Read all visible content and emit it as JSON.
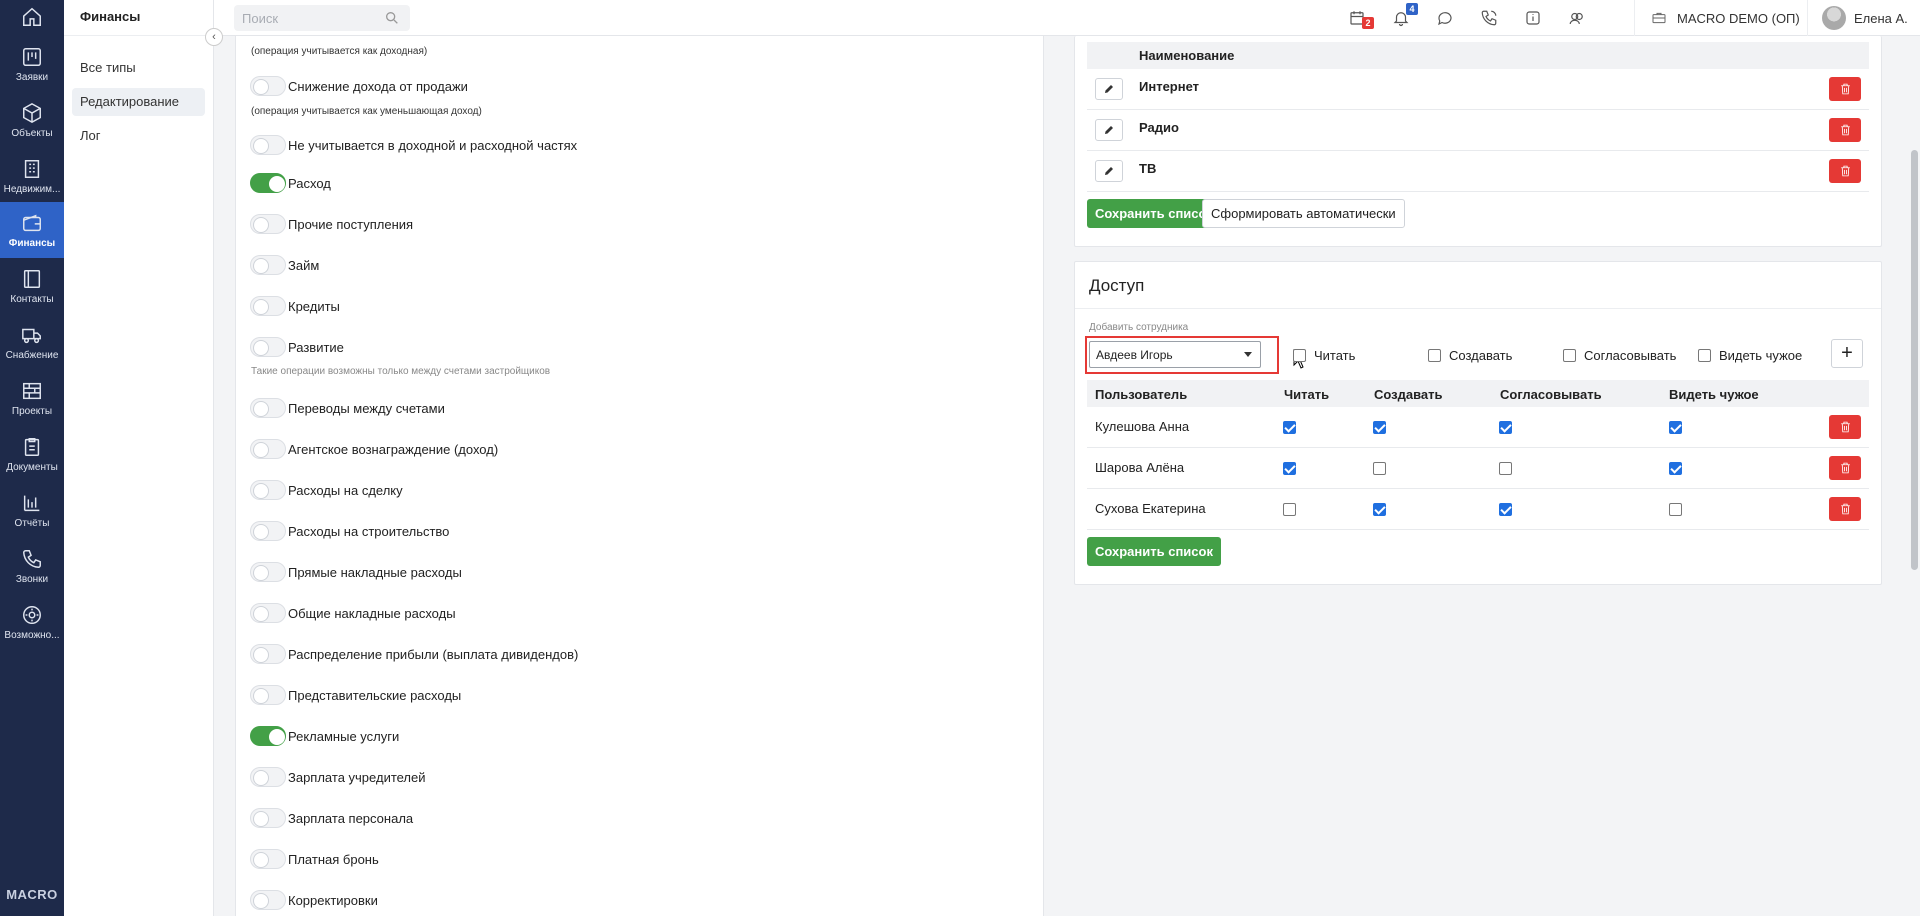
{
  "nav": {
    "items": [
      {
        "label": "",
        "icon": "home-icon"
      },
      {
        "label": "Заявки",
        "icon": "requests-icon"
      },
      {
        "label": "Объекты",
        "icon": "cube-icon"
      },
      {
        "label": "Недвижим...",
        "icon": "building-icon"
      },
      {
        "label": "Финансы",
        "icon": "wallet-icon"
      },
      {
        "label": "Контакты",
        "icon": "contacts-icon"
      },
      {
        "label": "Снабжение",
        "icon": "truck-icon"
      },
      {
        "label": "Проекты",
        "icon": "bricks-icon"
      },
      {
        "label": "Документы",
        "icon": "clipboard-icon"
      },
      {
        "label": "Отчёты",
        "icon": "report-icon"
      },
      {
        "label": "Звонки",
        "icon": "phone-icon"
      },
      {
        "label": "Возможно...",
        "icon": "gear-icon"
      }
    ],
    "brand": "MACRO"
  },
  "subnav": {
    "title": "Финансы",
    "items": [
      "Все типы",
      "Редактирование",
      "Лог"
    ]
  },
  "topbar": {
    "search_placeholder": "Поиск",
    "calendar_badge": "2",
    "bell_badge": "4",
    "company": "MACRO DEMO (ОП)",
    "user": "Елена А."
  },
  "toggles": {
    "top_hint": "(операция учитывается как доходная)",
    "items": [
      {
        "label": "Снижение дохода от продажи",
        "on": false,
        "hint": "(операция учитывается как уменьшающая доход)"
      },
      {
        "label": "Не учитывается в доходной и расходной частях",
        "on": false
      },
      {
        "label": "Расход",
        "on": true
      },
      {
        "label": "Прочие поступления",
        "on": false
      },
      {
        "label": "Займ",
        "on": false
      },
      {
        "label": "Кредиты",
        "on": false
      },
      {
        "label": "Развитие",
        "on": false,
        "hint": "Такие операции возможны только между счетами застройщиков"
      },
      {
        "label": "Переводы между счетами",
        "on": false
      },
      {
        "label": "Агентское вознаграждение (доход)",
        "on": false
      },
      {
        "label": "Расходы на сделку",
        "on": false
      },
      {
        "label": "Расходы на строительство",
        "on": false
      },
      {
        "label": "Прямые накладные расходы",
        "on": false
      },
      {
        "label": "Общие накладные расходы",
        "on": false
      },
      {
        "label": "Распределение прибыли (выплата дивидендов)",
        "on": false
      },
      {
        "label": "Представительские расходы",
        "on": false
      },
      {
        "label": "Рекламные услуги",
        "on": true
      },
      {
        "label": "Зарплата учредителей",
        "on": false
      },
      {
        "label": "Зарплата персонала",
        "on": false
      },
      {
        "label": "Платная бронь",
        "on": false
      },
      {
        "label": "Корректировки",
        "on": false
      }
    ]
  },
  "names_card": {
    "column": "Наименование",
    "rows": [
      "Интернет",
      "Радио",
      "ТВ"
    ],
    "save_label": "Сохранить список",
    "auto_label": "Сформировать автоматически"
  },
  "access_card": {
    "title": "Доступ",
    "add_label": "Добавить сотрудника",
    "selected_employee": "Авдеев Игорь",
    "perm_labels": [
      "Читать",
      "Создавать",
      "Согласовывать",
      "Видеть чужое"
    ],
    "columns": [
      "Пользователь",
      "Читать",
      "Создавать",
      "Согласовывать",
      "Видеть чужое"
    ],
    "rows": [
      {
        "user": "Кулешова Анна",
        "perms": [
          true,
          true,
          true,
          true
        ]
      },
      {
        "user": "Шарова Алёна",
        "perms": [
          true,
          false,
          false,
          true
        ]
      },
      {
        "user": "Сухова Екатерина",
        "perms": [
          false,
          true,
          true,
          false
        ]
      }
    ],
    "save_label": "Сохранить список",
    "add_button": "+"
  },
  "colors": {
    "nav_bg": "#1e2a4a",
    "nav_active": "#2f63c7",
    "green": "#43a047",
    "red": "#e53935",
    "highlight": "#e53935"
  }
}
